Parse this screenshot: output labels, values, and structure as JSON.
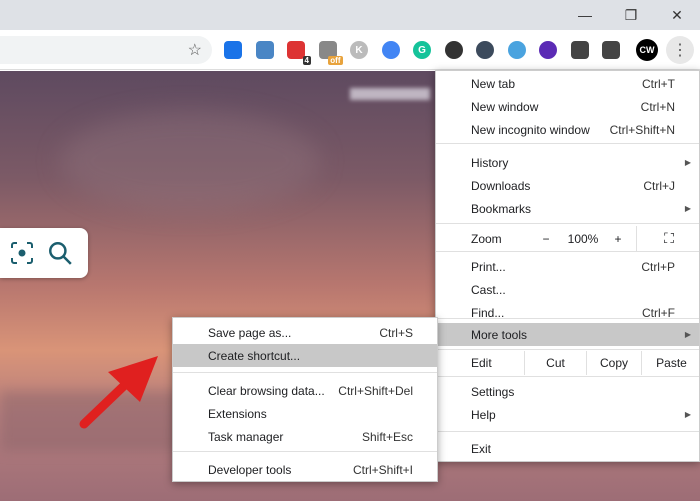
{
  "window": {
    "minimize": "—",
    "restore": "❐",
    "close": "✕"
  },
  "toolbar": {
    "extensions": [
      {
        "name": "stamp-extension-icon",
        "color": "#1a73e8"
      },
      {
        "name": "screen-extension-icon",
        "color": "#4a86c5"
      },
      {
        "name": "red-extension-icon",
        "color": "#d33",
        "badge": "4"
      },
      {
        "name": "off-extension-icon",
        "color": "#888",
        "badge": "off"
      },
      {
        "name": "k-extension-icon",
        "color": "#bbb",
        "text": "K"
      },
      {
        "name": "translate-extension-icon",
        "color": "#4285f4"
      },
      {
        "name": "grammarly-extension-icon",
        "color": "#15c39a",
        "text": "G"
      },
      {
        "name": "link-extension-icon",
        "color": "#333"
      },
      {
        "name": "cursor-extension-icon",
        "color": "#3c4a5c"
      },
      {
        "name": "bulb-extension-icon",
        "color": "#4aa3df"
      },
      {
        "name": "mic-extension-icon",
        "color": "#5b2bb5"
      },
      {
        "name": "puzzle-extensions-icon",
        "color": "#444"
      },
      {
        "name": "media-icon",
        "color": "#444"
      }
    ],
    "profile": "CW"
  },
  "menu": {
    "items": [
      {
        "label": "New tab",
        "shortcut": "Ctrl+T"
      },
      {
        "label": "New window",
        "shortcut": "Ctrl+N"
      },
      {
        "label": "New incognito window",
        "shortcut": "Ctrl+Shift+N"
      },
      {
        "label": "History",
        "arrow": true
      },
      {
        "label": "Downloads",
        "shortcut": "Ctrl+J"
      },
      {
        "label": "Bookmarks",
        "arrow": true
      },
      {
        "label": "Print...",
        "shortcut": "Ctrl+P"
      },
      {
        "label": "Cast..."
      },
      {
        "label": "Find...",
        "shortcut": "Ctrl+F"
      },
      {
        "label": "More tools",
        "arrow": true,
        "highlighted": true
      },
      {
        "label": "Settings"
      },
      {
        "label": "Help",
        "arrow": true
      },
      {
        "label": "Exit"
      }
    ],
    "zoom": {
      "label": "Zoom",
      "minus": "−",
      "value": "100%",
      "plus": "+"
    },
    "edit": {
      "label": "Edit",
      "cut": "Cut",
      "copy": "Copy",
      "paste": "Paste"
    }
  },
  "submenu": {
    "items": [
      {
        "label": "Save page as...",
        "shortcut": "Ctrl+S"
      },
      {
        "label": "Create shortcut...",
        "highlighted": true
      },
      {
        "label": "Clear browsing data...",
        "shortcut": "Ctrl+Shift+Del"
      },
      {
        "label": "Extensions"
      },
      {
        "label": "Task manager",
        "shortcut": "Shift+Esc"
      },
      {
        "label": "Developer tools",
        "shortcut": "Ctrl+Shift+I"
      }
    ]
  },
  "colors": {
    "accent_arrow": "#e0201f",
    "search_icon": "#1b5e6e"
  }
}
